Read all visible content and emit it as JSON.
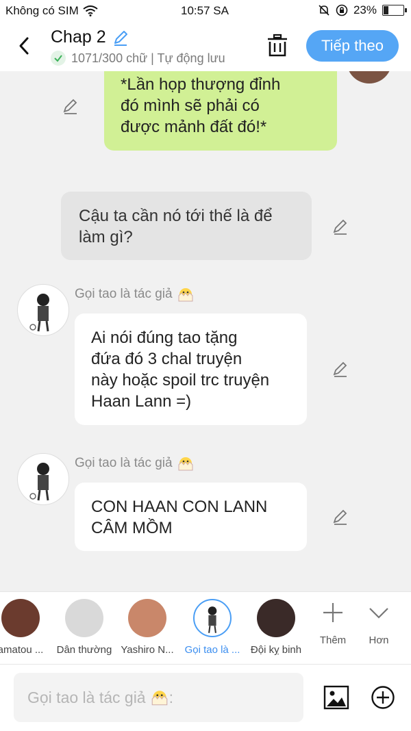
{
  "status_bar": {
    "carrier": "Không có SIM",
    "time": "10:57 SA",
    "battery": "23%",
    "battery_level": 0.23
  },
  "header": {
    "title": "Chap 2",
    "subtitle": "1071/300 chữ | Tự động lưu",
    "next_label": "Tiếp theo",
    "accent_color": "#55a6f5"
  },
  "messages": [
    {
      "type": "self",
      "text": "*Lần họp thượng đỉnh\nđó mình sẽ phải có\nđược mảnh đất đó!*",
      "color": "#d1f095"
    },
    {
      "type": "narration",
      "text": "Cậu ta cần nó tới thế là để\nlàm gì?"
    },
    {
      "type": "character",
      "author": "Gọi tao là tác giả",
      "text": "Ai nói đúng tao tặng\nđứa đó 3 chal truyện\nnày hoặc spoil trc truyện\nHaan Lann =)"
    },
    {
      "type": "character",
      "author": "Gọi tao là tác giả",
      "text": "CON HAAN CON LANN\nCÂM MỒM"
    }
  ],
  "roles": [
    {
      "name": "amatou ..."
    },
    {
      "name": "Dân thường"
    },
    {
      "name": "Yashiro N..."
    },
    {
      "name": "Gọi tao là ...",
      "selected": true
    },
    {
      "name": "Đội kỵ binh"
    }
  ],
  "tools": {
    "more_label": "Thêm",
    "other_label": "Hơn"
  },
  "composer": {
    "placeholder": "Gọi tao là tác giả",
    "suffix": ":"
  }
}
